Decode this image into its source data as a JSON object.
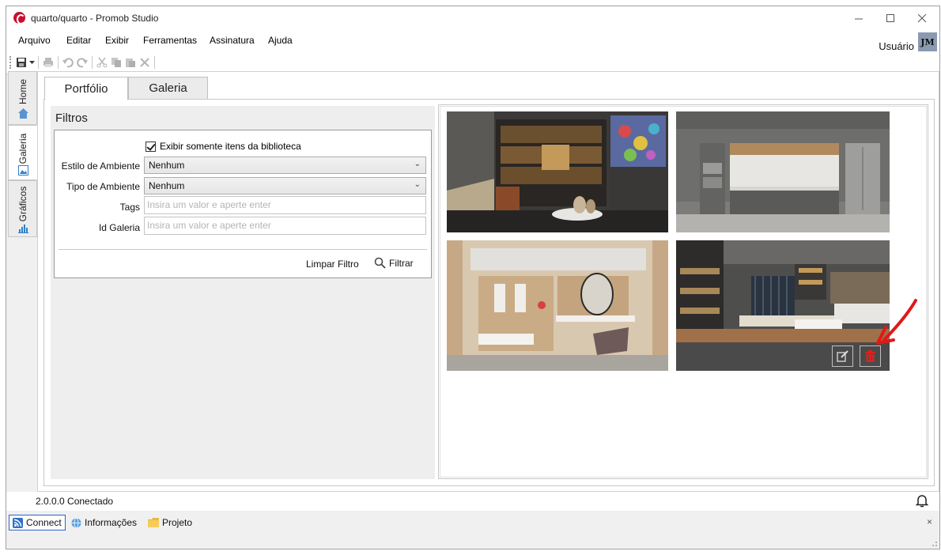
{
  "window": {
    "title": "quarto/quarto - Promob Studio",
    "minimize_icon": "minimize-icon",
    "maximize_icon": "maximize-icon",
    "close_icon": "close-icon"
  },
  "menu": {
    "items": [
      "Arquivo",
      "Editar",
      "Exibir",
      "Ferramentas",
      "Assinatura",
      "Ajuda"
    ]
  },
  "toolbar": {
    "icons": [
      "save-icon",
      "dropdown-icon",
      "print-icon",
      "undo-icon",
      "redo-icon",
      "cut-icon",
      "copy-icon",
      "paste-icon",
      "delete-icon"
    ]
  },
  "user": {
    "label": "Usuário",
    "initials": "JM"
  },
  "sidebar": {
    "tabs": [
      {
        "label": "Home",
        "icon": "home-icon"
      },
      {
        "label": "Galeria",
        "icon": "gallery-icon",
        "selected": true
      },
      {
        "label": "Gráficos",
        "icon": "chart-icon"
      }
    ]
  },
  "tabs": {
    "portfolio": "Portfólio",
    "galeria": "Galeria"
  },
  "filters": {
    "title": "Filtros",
    "checkbox_label": "Exibir somente itens da biblioteca",
    "checkbox_checked": true,
    "estilo_label": "Estilo de Ambiente",
    "estilo_value": "Nenhum",
    "tipo_label": "Tipo de Ambiente",
    "tipo_value": "Nenhum",
    "tags_label": "Tags",
    "tags_placeholder": "Insira um valor e aperte enter",
    "id_label": "Id Galeria",
    "id_placeholder": "Insira um valor e aperte enter",
    "clear_label": "Limpar Filtro",
    "filter_label": "Filtrar"
  },
  "gallery": {
    "items": [
      {
        "scene": "living-room-shelves"
      },
      {
        "scene": "gray-kitchen"
      },
      {
        "scene": "dressing-room"
      },
      {
        "scene": "open-kitchen-dining",
        "hovered": true
      }
    ],
    "edit_icon": "edit-icon",
    "delete_icon": "trash-icon",
    "delete_color": "#e02020"
  },
  "status": {
    "text": "2.0.0.0  Conectado"
  },
  "bottom": {
    "tabs": [
      "Connect",
      "Informações",
      "Projeto"
    ],
    "close": "×"
  }
}
